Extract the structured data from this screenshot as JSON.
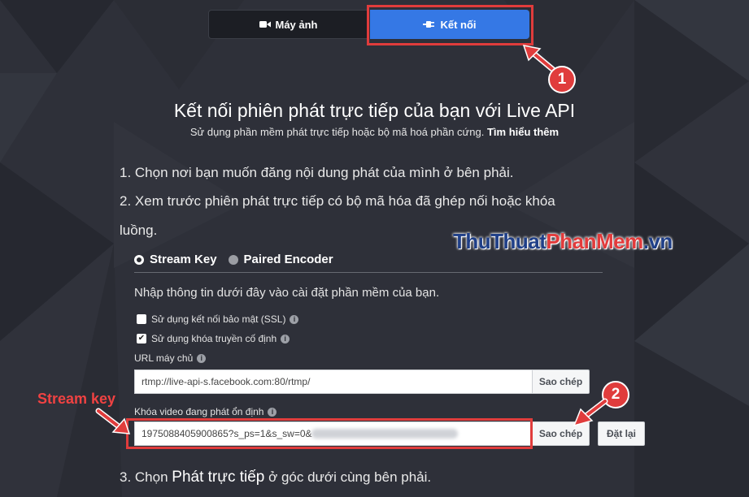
{
  "tabs": {
    "camera_label": "Máy ảnh",
    "connect_label": "Kết nối"
  },
  "header": {
    "title": "Kết nối phiên phát trực tiếp của bạn với Live API",
    "subtitle": "Sử dụng phần mềm phát trực tiếp hoặc bộ mã hoá phần cứng.",
    "learn_more": "Tìm hiểu thêm"
  },
  "steps": {
    "step1": "1. Chọn nơi bạn muốn đăng nội dung phát của mình ở bên phải.",
    "step2_line1": "2. Xem trước phiên phát trực tiếp có bộ mã hóa đã ghép nối hoặc khóa",
    "step2_line2": "luồng.",
    "step3_prefix": "3. Chọn ",
    "step3_bold": "Phát trực tiếp",
    "step3_suffix": " ở góc dưới cùng bên phải."
  },
  "mode": {
    "stream_key": "Stream Key",
    "paired_encoder": "Paired Encoder",
    "selected": "Stream Key"
  },
  "form": {
    "instruction": "Nhập thông tin dưới đây vào cài đặt phần mềm của bạn.",
    "ssl_label": "Sử dụng kết nối bảo mật (SSL)",
    "ssl_checked": false,
    "persistent_label": "Sử dụng khóa truyền cố định",
    "persistent_checked": true,
    "server_url_label": "URL máy chủ",
    "server_url_value": "rtmp://live-api-s.facebook.com:80/rtmp/",
    "copy_label": "Sao chép",
    "stream_key_label": "Khóa video đang phát ổn định",
    "stream_key_value": "1975088405900865?s_ps=1&s_sw=0&",
    "reset_label": "Đặt lại"
  },
  "annotations": {
    "stream_key_callout": "Stream key",
    "badge_1": "1",
    "badge_2": "2"
  },
  "watermark": {
    "part1": "Thu",
    "part2": "Thuat",
    "part3": "PhanMem",
    "part4": ".vn"
  },
  "colors": {
    "accent": "#3578e5",
    "highlight_red": "#e03c3c",
    "background": "#2c2f38"
  }
}
